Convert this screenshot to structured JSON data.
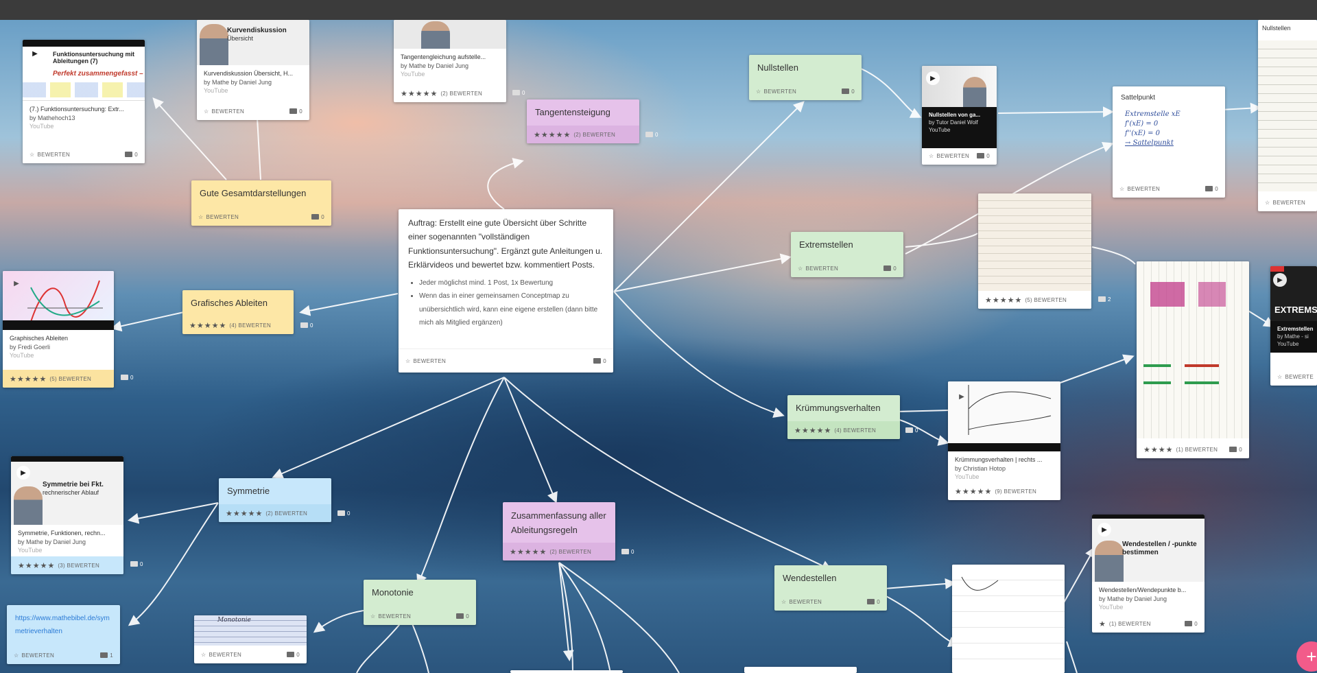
{
  "cards": {
    "gesamt": {
      "title": "Gute Gesamtdarstellungen",
      "rate": "BEWERTEN",
      "comments": "0"
    },
    "grafisch": {
      "title": "Grafisches Ableiten",
      "stars": "★★★★★",
      "rate": "(4)  BEWERTEN",
      "comments": "0"
    },
    "tangsteig": {
      "title": "Tangentensteigung",
      "stars": "★★★★★",
      "rate": "(2)  BEWERTEN",
      "comments": "0"
    },
    "nullstellen": {
      "title": "Nullstellen",
      "rate": "BEWERTEN",
      "comments": "0"
    },
    "extrem": {
      "title": "Extremstellen",
      "rate": "BEWERTEN",
      "comments": "0"
    },
    "kruemmung": {
      "title": "Krümmungsverhalten",
      "stars": "★★★★★",
      "rate": "(4)  BEWERTEN",
      "comments": "0"
    },
    "symmetrie": {
      "title": "Symmetrie",
      "stars": "★★★★★",
      "rate": "(2)  BEWERTEN",
      "comments": "0"
    },
    "zusammen": {
      "title": "Zusammenfassung aller Ableitungsregeln",
      "stars": "★★★★★",
      "rate": "(2)  BEWERTEN",
      "comments": "0"
    },
    "monotonie": {
      "title": "Monotonie",
      "rate": "BEWERTEN",
      "comments": "0"
    },
    "wendestellen": {
      "title": "Wendestellen",
      "rate": "BEWERTEN",
      "comments": "0"
    },
    "link": {
      "title": "https://www.mathebibel.de/symmetrieverhalten",
      "rate": "BEWERTEN",
      "comments": "1"
    },
    "sattel": {
      "title": "Sattelpunkt",
      "rate": "BEWERTEN",
      "comments": "0",
      "note": [
        "Extremstelle  xE",
        "f'(xE) = 0",
        "f''(xE) = 0",
        "→ Sattelpunkt"
      ]
    },
    "nullcut": {
      "title": "Nullstellen",
      "rate": "BEWERTEN"
    },
    "main": {
      "text": "Auftrag: Erstellt eine gute Übersicht über Schritte einer sogenannten \"vollständigen Funktionsuntersuchung\". Ergänzt gute Anleitungen u. Erklärvideos und bewertet bzw. kommentiert Posts.",
      "bullet1": "Jeder möglichst mind. 1 Post, 1x Bewertung",
      "bullet2": "Wenn das in einer gemeinsamen Conceptmap zu unübersichtlich wird, kann eine eigene erstellen (dann bitte mich als Mitglied ergänzen)",
      "rate": "BEWERTEN",
      "comments": "0"
    }
  },
  "videos": {
    "funktion": {
      "thumb": "Funktionsuntersuchung mit Ableitungen (7)",
      "sub": "Perfekt zusammengefasst –",
      "title": "(7.) Funktionsuntersuchung: Extr...",
      "by": "by Mathehoch13",
      "src": "YouTube",
      "rate": "BEWERTEN",
      "comments": "0"
    },
    "kurven": {
      "thumb": "Kurvendiskussion",
      "thumb2": "Übersicht",
      "title": "Kurvendiskussion Übersicht, H...",
      "by": "by Mathe by Daniel Jung",
      "src": "YouTube",
      "rate": "BEWERTEN",
      "comments": "0"
    },
    "tangente": {
      "title": "Tangentengleichung aufstelle...",
      "by": "by Mathe by Daniel Jung",
      "src": "YouTube",
      "stars": "★★★★★",
      "rate": "(2)  BEWERTEN",
      "comments": "0"
    },
    "graphisch": {
      "title": "Graphisches Ableiten",
      "by": "by Fredi Goerli",
      "src": "YouTube",
      "stars": "★★★★★",
      "rate": "(5)  BEWERTEN",
      "comments": "0"
    },
    "nullvid": {
      "title": "Nullstellen von ga...",
      "by": "by Tutor Daniel Wolf",
      "src": "YouTube",
      "rate": "BEWERTEN",
      "comments": "0"
    },
    "extremvid": {
      "thumb": "EXTREMS",
      "title": "Extremstellen",
      "by": "by Mathe - si",
      "src": "YouTube",
      "rate": "BEWERTE"
    },
    "kruemmvid": {
      "title": "Krümmungsverhalten | rechts ...",
      "by": "by Christian Hotop",
      "src": "YouTube",
      "stars": "★★★★★",
      "rate": "(9)  BEWERTEN",
      "comments": "0"
    },
    "symvid": {
      "thumb": "Symmetrie bei Fkt.",
      "thumb2": "rechnerischer Ablauf",
      "title": "Symmetrie, Funktionen, rechn...",
      "by": "by Mathe by Daniel Jung",
      "src": "YouTube",
      "stars": "★★★★★",
      "rate": "(3)  BEWERTEN",
      "comments": "0"
    },
    "wendevid": {
      "thumb": "Wendestellen / -punkte bestimmen",
      "title": "Wendestellen/Wendepunkte b...",
      "by": "by Mathe by Daniel Jung",
      "src": "YouTube",
      "stars": "★",
      "rate": "(1)  BEWERTEN",
      "comments": "0"
    }
  },
  "images": {
    "extremnote": {
      "stars": "★★★★★",
      "rate": "(5)  BEWERTEN",
      "comments": "2"
    },
    "bignote": {
      "stars": "★★★★",
      "rate": "(1)  BEWERTEN",
      "comments": "0"
    },
    "monotnote": {
      "title": "Monotonie",
      "rate": "BEWERTEN",
      "comments": "0"
    }
  },
  "fab": "+"
}
